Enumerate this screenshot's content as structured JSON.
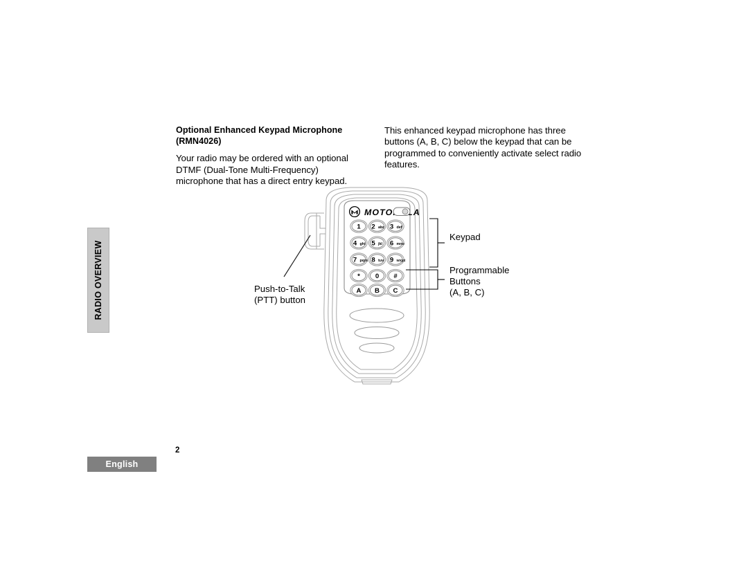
{
  "page": {
    "number": "2",
    "language_tab": "English",
    "side_tab": "RADIO OVERVIEW"
  },
  "content": {
    "heading": "Optional Enhanced Keypad Microphone (RMN4026)",
    "left_paragraph": "Your radio may be ordered with an optional DTMF (Dual-Tone Multi-Frequency) microphone that has a direct entry keypad.",
    "right_paragraph": "This enhanced keypad microphone has three buttons (A, B, C) below the keypad that can be programmed to conveniently activate select radio features."
  },
  "illustration": {
    "brand": "MOTOROLA",
    "keypad": {
      "rows": [
        [
          {
            "digit": "1",
            "letters": ""
          },
          {
            "digit": "2",
            "letters": "abc"
          },
          {
            "digit": "3",
            "letters": "def"
          }
        ],
        [
          {
            "digit": "4",
            "letters": "ghi"
          },
          {
            "digit": "5",
            "letters": "jkl"
          },
          {
            "digit": "6",
            "letters": "mno"
          }
        ],
        [
          {
            "digit": "7",
            "letters": "pqrs"
          },
          {
            "digit": "8",
            "letters": "tuv"
          },
          {
            "digit": "9",
            "letters": "wxyz"
          }
        ],
        [
          {
            "digit": "*",
            "letters": ""
          },
          {
            "digit": "0",
            "letters": ""
          },
          {
            "digit": "#",
            "letters": ""
          }
        ],
        [
          {
            "digit": "A",
            "letters": ""
          },
          {
            "digit": "B",
            "letters": ""
          },
          {
            "digit": "C",
            "letters": ""
          }
        ]
      ]
    },
    "callouts": {
      "keypad": "Keypad",
      "programmable": "Programmable\nButtons\n(A, B, C)",
      "ptt": "Push-to-Talk\n(PTT) button"
    }
  },
  "colors": {
    "side_tab_bg": "#c9c9c9",
    "footer_bg": "#808080",
    "footer_text": "#ffffff",
    "line": "#000000",
    "device_outline": "#a9a9a9"
  }
}
